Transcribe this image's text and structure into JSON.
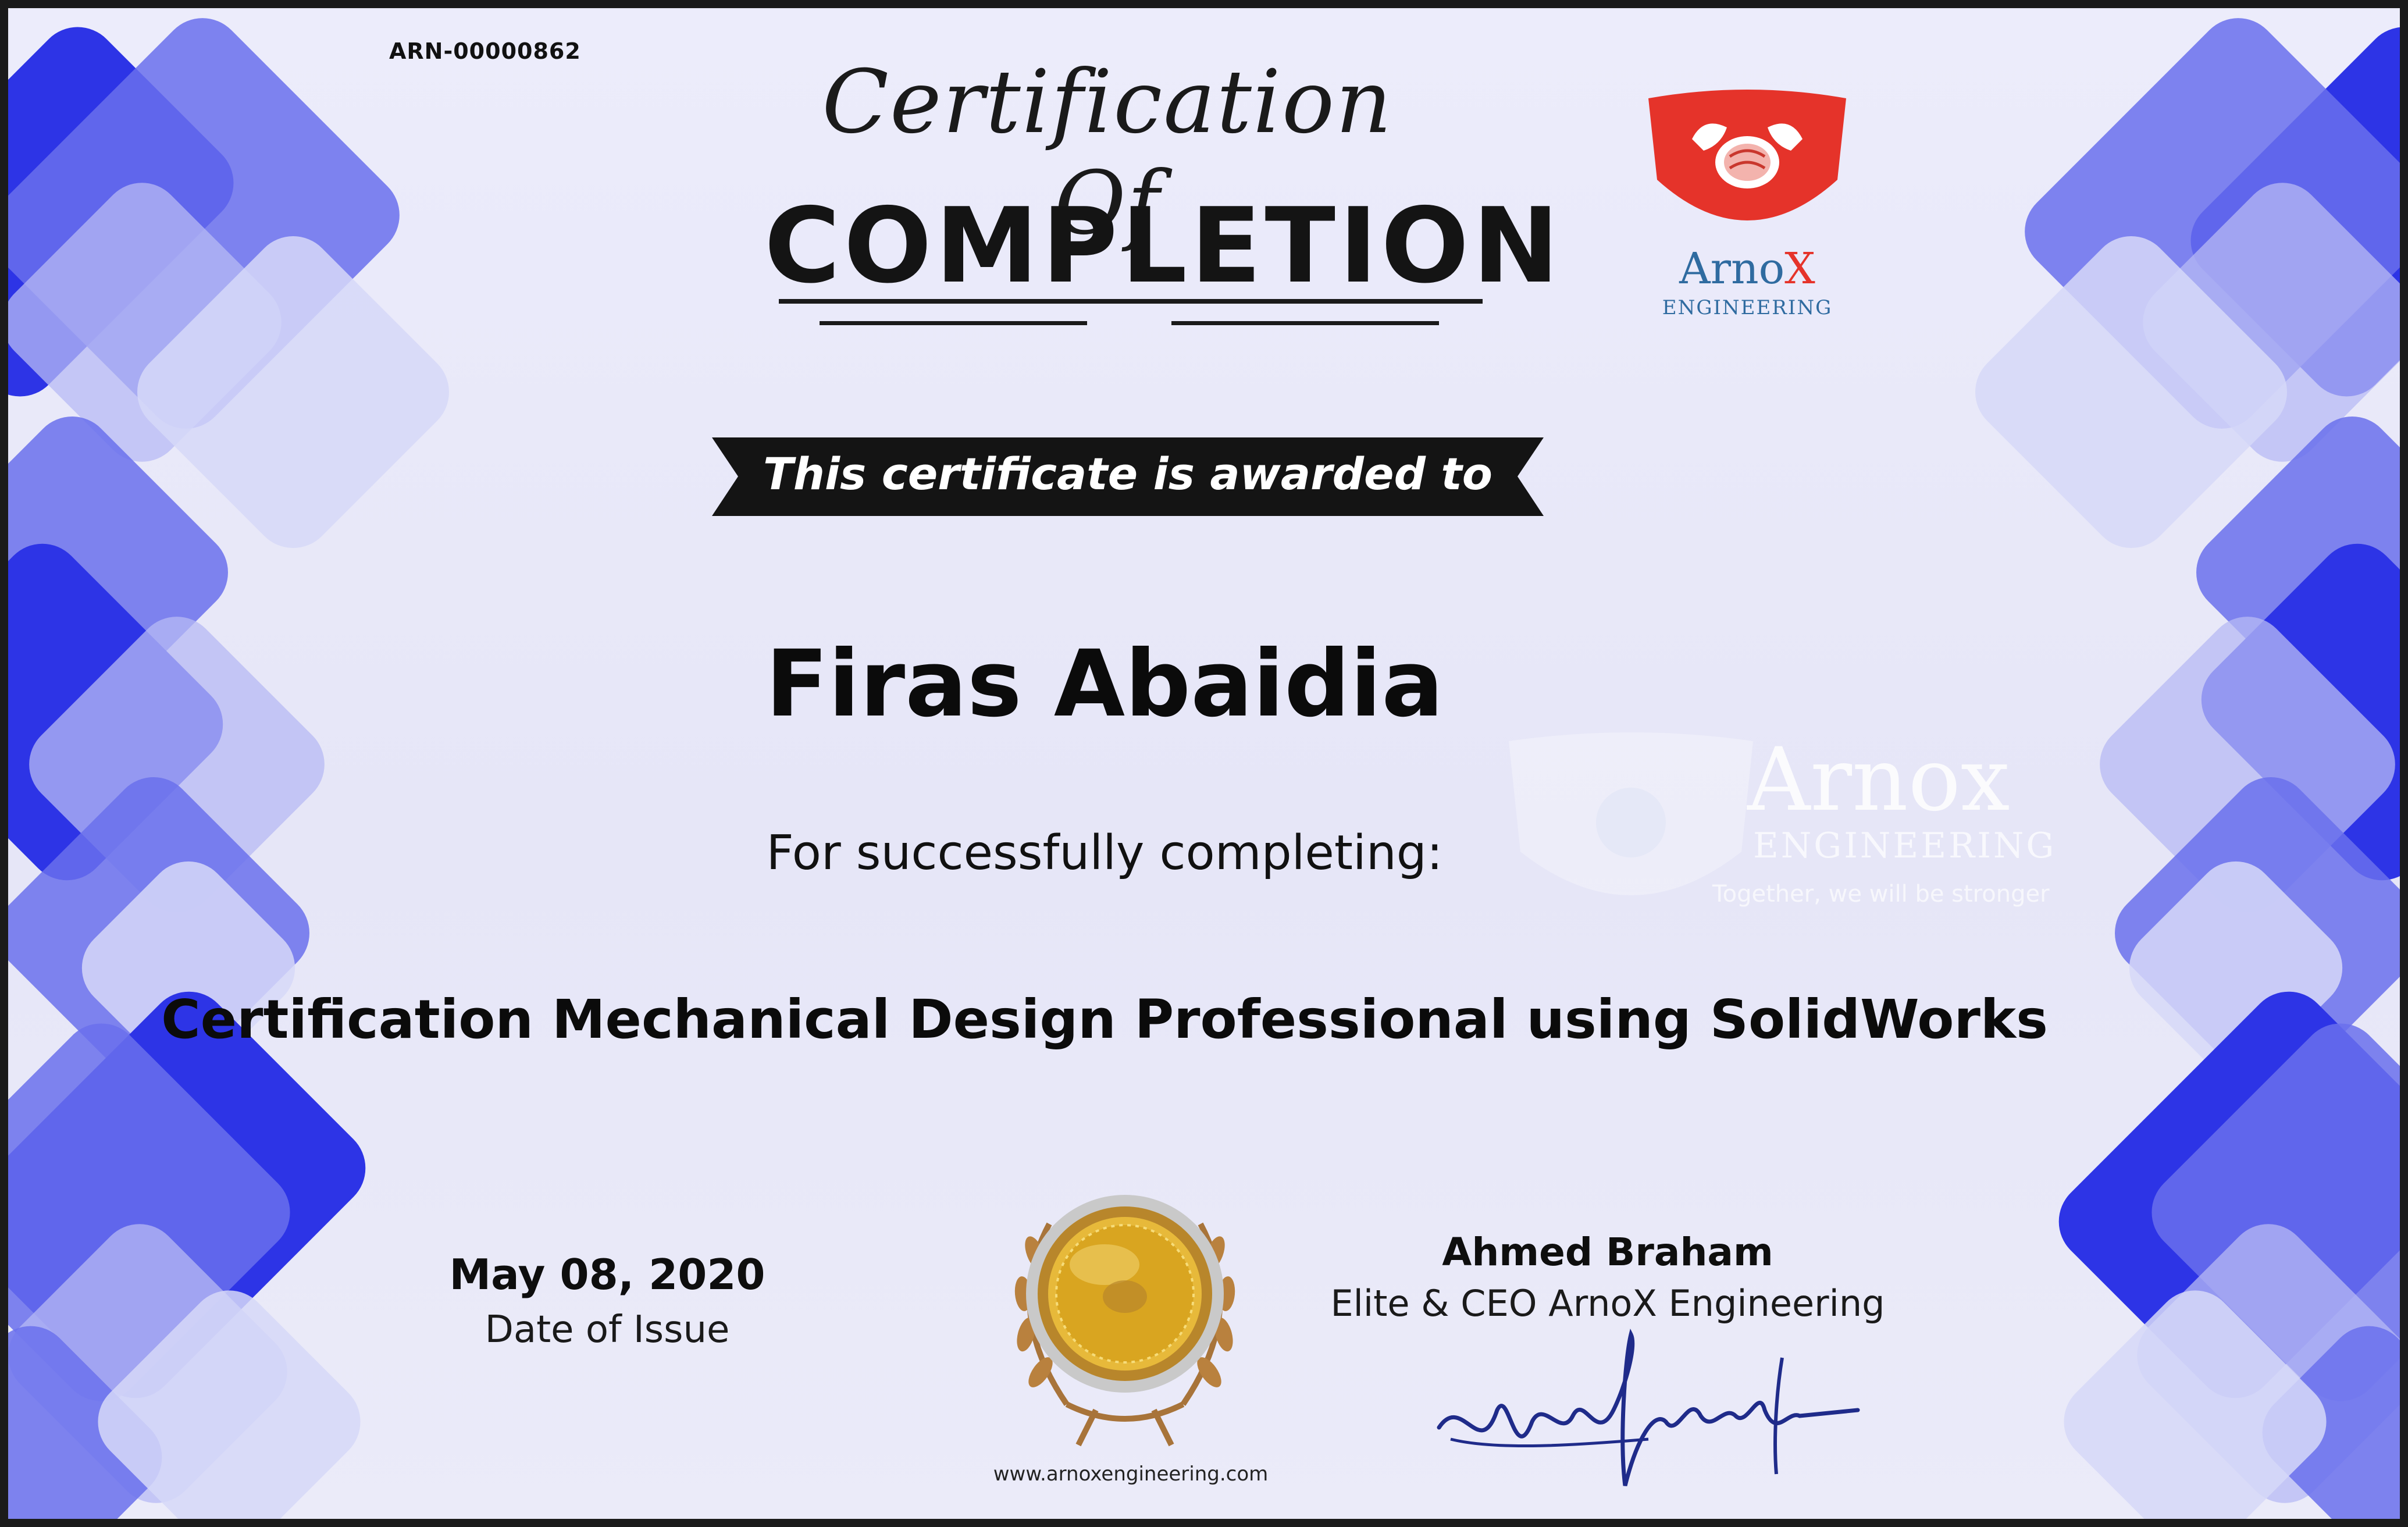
{
  "certificate": {
    "reference": "ARN-00000862",
    "title_script": "Certification Of",
    "title_main": "COMPLETION",
    "ribbon_text": "This certificate is awarded to",
    "recipient": "Firas Abaidia",
    "for_text": "For successfully completing:",
    "course": "Certification Mechanical Design Professional using SolidWorks",
    "date": "May 08, 2020",
    "date_label": "Date of Issue",
    "signer_name": "Ahmed Braham",
    "signer_role": "Elite & CEO ArnoX Engineering",
    "website": "www.arnoxengineering.com"
  },
  "logo": {
    "word_start": "Arno",
    "word_end": "X",
    "subtitle": "ENGINEERING"
  },
  "watermark": {
    "word": "Arnox",
    "subtitle": "ENGINEERING",
    "tagline": "Together, we will be stronger"
  },
  "colors": {
    "accent_blue": "#2d34e6",
    "mid_blue": "#6a70ec",
    "ribbon": "#141414",
    "logo_red": "#e5332a",
    "logo_blue": "#2f6ba0",
    "medal_gold": "#d9a520"
  }
}
